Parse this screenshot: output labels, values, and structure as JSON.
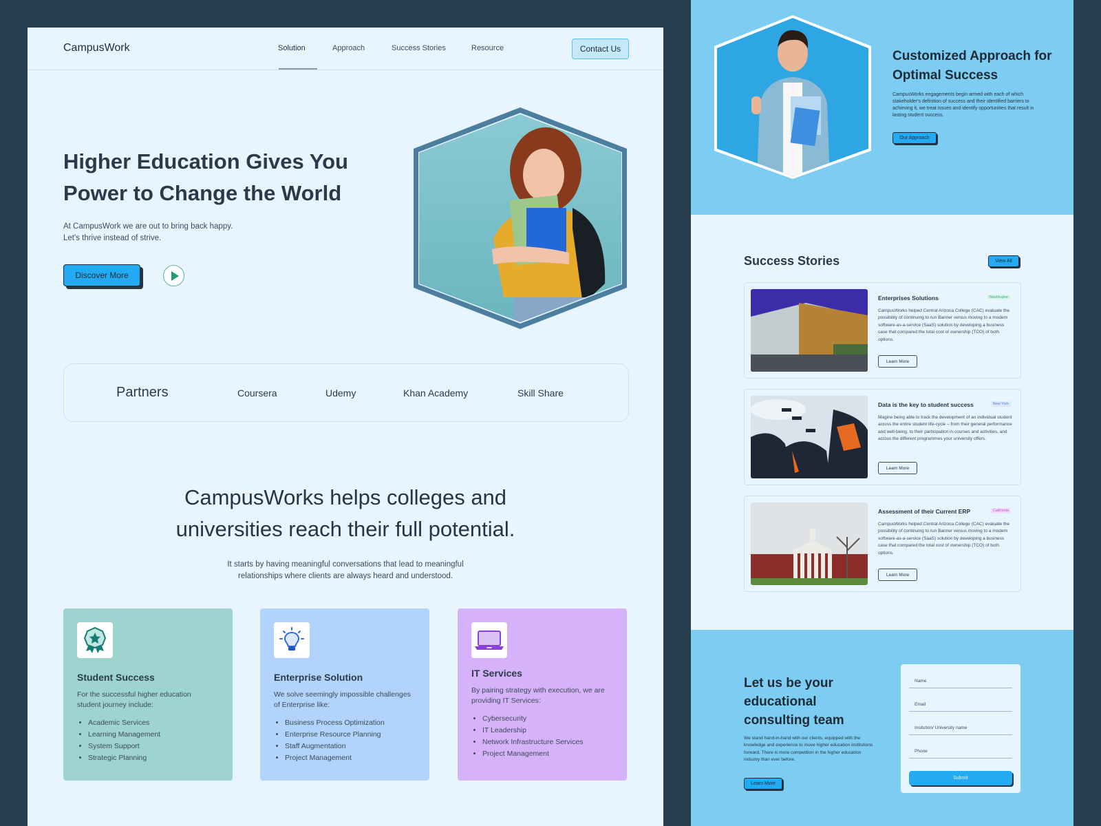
{
  "nav": {
    "logo": "CampusWork",
    "items": [
      {
        "label": "Solution",
        "active": true
      },
      {
        "label": "Approach"
      },
      {
        "label": "Success Stories"
      },
      {
        "label": "Resource"
      }
    ],
    "contact_label": "Contact Us"
  },
  "hero": {
    "title": "Higher Education Gives You Power to Change the World",
    "subtitle_line1": "At CampusWork we are out to bring back happy.",
    "subtitle_line2": "Let's thrive instead of strive.",
    "discover_label": "Discover More",
    "play_icon": "play-icon",
    "image_alt": "Smiling student holding notebooks with backpack"
  },
  "partners": {
    "title": "Partners",
    "items": [
      "Coursera",
      "Udemy",
      "Khan Academy",
      "Skill Share"
    ]
  },
  "mission": {
    "title_line1": "CampusWorks helps colleges and",
    "title_line2": "universities reach their full potential.",
    "sub_line1": "It starts by having meaningful conversations that lead to meaningful",
    "sub_line2": "relationships where clients are always heard and understood."
  },
  "services": [
    {
      "icon": "award-badge-icon",
      "title": "Student Success",
      "desc": "For the successful higher education student journey include:",
      "items": [
        "Academic Services",
        "Learning Management",
        "System Support",
        "Strategic Planning"
      ],
      "color": "#9ed4cf"
    },
    {
      "icon": "lightbulb-icon",
      "title": "Enterprise Solution",
      "desc": "We solve seemingly impossible challenges of Enterprise like:",
      "items": [
        "Business Process Optimization",
        "Enterprise Resource Planning",
        "Staff Augmentation",
        "Project Management"
      ],
      "color": "#b2d3fc"
    },
    {
      "icon": "laptop-icon",
      "title": "IT Services",
      "desc": "By pairing strategy with execution, we are providing IT Services:",
      "items": [
        "Cybersecurity",
        " IT Leadership",
        "Network Infrastructure Services",
        "Project Management"
      ],
      "color": "#d6b2fb"
    }
  ],
  "approach": {
    "title": "Customized Approach for Optimal Success",
    "desc": "CampusWorks engagements begin armed with each of which stakeholder's definition of success and their identified barriers to achieving it, we treat issues and identify opportunities that result in lasting student success.",
    "button_label": "Our Approach",
    "image_alt": "Smiling student giving thumbs up holding notebooks"
  },
  "stories": {
    "title": "Success Stories",
    "view_all_label": "View All",
    "items": [
      {
        "title": "Enterprises Solutions",
        "tag": "Washington",
        "tag_color": "#2bb07a",
        "tag_bg": "#def5ee",
        "body": "CampusWorks helped Central Arizona College (CAC) evaluate the possibility of continuing to run Banner versus moving to a modern software-as-a-service (SaaS) solution by developing a business case that compared the total cost of ownership (TCO) of both options.",
        "button": "Learn More",
        "image_alt": "Modern campus building at dusk"
      },
      {
        "title": "Data is the key to student success",
        "tag": "New York",
        "tag_color": "#5a7fd6",
        "tag_bg": "#dde8fb",
        "body": "Magine being able to track the development of an individual student across the entire student life-cycle – from their general performance and well-being, to their participation in courses and activities, and across the different programmes your university offers.",
        "button": "Learn More",
        "image_alt": "Graduates throwing caps in the air"
      },
      {
        "title": "Assessment of their Current ERP",
        "tag": "California",
        "tag_color": "#b44fd6",
        "tag_bg": "#f1def9",
        "body": "CampusWorks helped Central Arizona College (CAC) evaluate the possibility of continuing to run Banner versus moving to a modern software-as-a-service (SaaS) solution by developing a business case that compared the total cost of ownership (TCO) of both options.",
        "button": "Learn More",
        "image_alt": "Historic red brick college building"
      }
    ]
  },
  "contact": {
    "title": "Let us be your educational consulting team",
    "desc": "We stand hand-in-hand with our clients, equipped with the knowledge and experience to move higher education institutions forward. There is more competition in the higher education industry than ever before.",
    "button_label": "Learn More",
    "form": {
      "name_placeholder": "Name",
      "email_placeholder": "Email",
      "institution_placeholder": "Insitution/ University name",
      "phone_placeholder": "Phone",
      "submit_label": "Submit"
    }
  }
}
